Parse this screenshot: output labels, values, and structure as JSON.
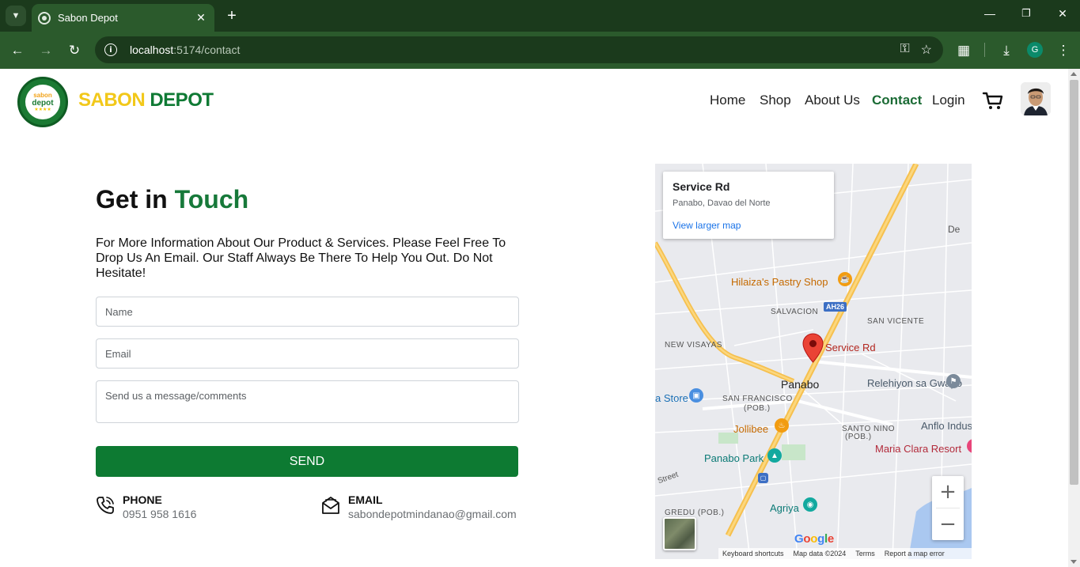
{
  "browser": {
    "tab_title": "Sabon Depot",
    "url_host": "localhost",
    "url_path": ":5174/contact",
    "profile_initial": "G"
  },
  "site": {
    "brand_part1": "SABON",
    "brand_part2": "DEPOT",
    "logo_text_1": "sabon",
    "logo_text_2": "depot",
    "nav": [
      "Home",
      "Shop",
      "About Us",
      "Contact",
      "Login"
    ],
    "active_nav": "Contact"
  },
  "contact": {
    "title_part1": "Get in",
    "title_part2": "Touch",
    "description": "For More Information About Our Product & Services. Please Feel Free To Drop Us An Email. Our Staff Always Be There To Help You Out. Do Not Hesitate!",
    "name_placeholder": "Name",
    "email_placeholder": "Email",
    "message_placeholder": "Send us a message/comments",
    "send_label": "SEND",
    "phone_label": "PHONE",
    "phone_value": "0951 958 1616",
    "email_label": "EMAIL",
    "email_value": "sabondepotmindanao@gmail.com"
  },
  "map": {
    "card_title": "Service Rd",
    "card_subtitle": "Panabo, Davao del Norte",
    "card_link": "View larger map",
    "pin_label": "Service Rd",
    "highway_shield": "AH26",
    "labels": {
      "de": "De",
      "pastry": "Hilaiza's Pastry Shop",
      "salvacion": "SALVACION",
      "san_vicente": "SAN VICENTE",
      "new_visayas": "NEW VISAYAS",
      "panabo": "Panabo",
      "relehiyon": "Relehiyon sa Gwapo",
      "store": "a Store",
      "san_francisco_1": "SAN FRANCISCO",
      "san_francisco_2": "(POB.)",
      "jollibee": "Jollibee",
      "santo_nino_1": "SANTO NINO",
      "santo_nino_2": "(POB.)",
      "anflo": "Anflo Indus",
      "maria_clara": "Maria Clara Resort",
      "panabo_park": "Panabo Park",
      "street": "Street",
      "agriya": "Agriya",
      "gredu": "GREDU (POB.)"
    },
    "attribution": [
      "Keyboard shortcuts",
      "Map data ©2024",
      "Terms",
      "Report a map error"
    ],
    "google": "Google"
  }
}
